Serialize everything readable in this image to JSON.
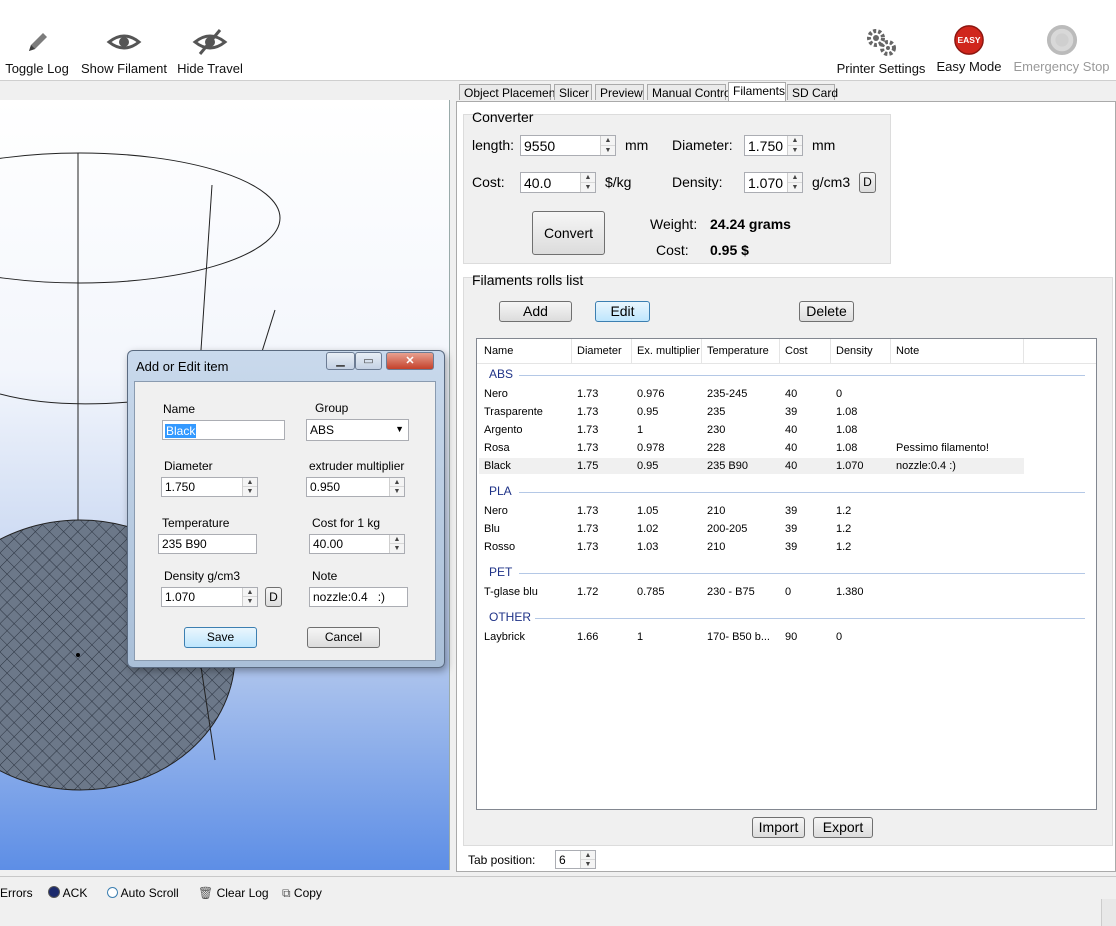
{
  "toolbar": {
    "left_buttons": [
      {
        "label": "Toggle Log",
        "icon": "pencil-icon"
      },
      {
        "label": "Show Filament",
        "icon": "eye-icon"
      },
      {
        "label": "Hide Travel",
        "icon": "eye-slash-icon"
      }
    ],
    "right_buttons": [
      {
        "label": "Printer Settings",
        "icon": "gears-icon"
      },
      {
        "label": "Easy Mode",
        "icon": "easy-icon",
        "badge": "EASY"
      },
      {
        "label": "Emergency Stop",
        "icon": "emergency-stop-icon",
        "disabled": true
      }
    ]
  },
  "tabs": [
    "Object Placement",
    "Slicer",
    "Preview",
    "Manual Control",
    "Filaments",
    "SD Card"
  ],
  "active_tab": "Filaments",
  "converter": {
    "title": "Converter",
    "length_label": "length:",
    "length_value": "9550",
    "length_unit": "mm",
    "diameter_label": "Diameter:",
    "diameter_value": "1.750",
    "diameter_unit": "mm",
    "cost_label": "Cost:",
    "cost_value": "40.0",
    "cost_unit": "$/kg",
    "density_label": "Density:",
    "density_value": "1.070",
    "density_unit": "g/cm3",
    "density_button": "D",
    "convert_button": "Convert",
    "weight_label": "Weight:",
    "weight_value": "24.24 grams",
    "cost_result_label": "Cost:",
    "cost_result_value": "0.95 $"
  },
  "rolls": {
    "title": "Filaments rolls list",
    "add_button": "Add",
    "edit_button": "Edit",
    "delete_button": "Delete",
    "columns": [
      "Name",
      "Diameter",
      "Ex. multiplier",
      "Temperature",
      "Cost",
      "Density",
      "Note"
    ],
    "groups": [
      {
        "name": "ABS",
        "rows": [
          [
            "Nero",
            "1.73",
            "0.976",
            "235-245",
            "40",
            "0",
            ""
          ],
          [
            "Trasparente",
            "1.73",
            "0.95",
            "235",
            "39",
            "1.08",
            ""
          ],
          [
            "Argento",
            "1.73",
            "1",
            "230",
            "40",
            "1.08",
            ""
          ],
          [
            "Rosa",
            "1.73",
            "0.978",
            "228",
            "40",
            "1.08",
            "Pessimo filamento!"
          ],
          [
            "Black",
            "1.75",
            "0.95",
            "235 B90",
            "40",
            "1.070",
            "nozzle:0.4   :)"
          ]
        ]
      },
      {
        "name": "PLA",
        "rows": [
          [
            "Nero",
            "1.73",
            "1.05",
            "210",
            "39",
            "1.2",
            ""
          ],
          [
            "Blu",
            "1.73",
            "1.02",
            "200-205",
            "39",
            "1.2",
            ""
          ],
          [
            "Rosso",
            "1.73",
            "1.03",
            "210",
            "39",
            "1.2",
            ""
          ]
        ]
      },
      {
        "name": "PET",
        "rows": [
          [
            "T-glase blu",
            "1.72",
            "0.785",
            "230 - B75",
            "0",
            "1.380",
            ""
          ]
        ]
      },
      {
        "name": "OTHER",
        "rows": [
          [
            "Laybrick",
            "1.66",
            "1",
            "170- B50 b...",
            "90",
            "0",
            ""
          ]
        ]
      }
    ],
    "import_button": "Import",
    "export_button": "Export"
  },
  "tab_position": {
    "label": "Tab position:",
    "value": "6"
  },
  "dialog": {
    "title": "Add or Edit item",
    "name_label": "Name",
    "name_value": "Black",
    "group_label": "Group",
    "group_value": "ABS",
    "diameter_label": "Diameter",
    "diameter_value": "1.750",
    "extruder_label": "extruder multiplier",
    "extruder_value": "0.950",
    "temperature_label": "Temperature",
    "temperature_value": "235 B90",
    "costkg_label": "Cost for 1 kg",
    "costkg_value": "40.00",
    "density_label": "Density g/cm3",
    "density_value": "1.070",
    "density_button": "D",
    "note_label": "Note",
    "note_value": "nozzle:0.4   :)",
    "save_button": "Save",
    "cancel_button": "Cancel"
  },
  "bottombar": {
    "items": [
      {
        "label": "Errors",
        "icon": ""
      },
      {
        "label": "ACK",
        "icon": "radio-dot-icon"
      },
      {
        "label": "Auto Scroll",
        "icon": "radio-empty-icon"
      },
      {
        "label": "Clear Log",
        "icon": "trash-icon"
      },
      {
        "label": "Copy",
        "icon": "copy-icon"
      }
    ]
  },
  "colors": {
    "accent": "#3c7fb1",
    "group_header": "#1e3287",
    "view_bottom": "#5d8ee6",
    "easy_badge": "#d0261c"
  }
}
